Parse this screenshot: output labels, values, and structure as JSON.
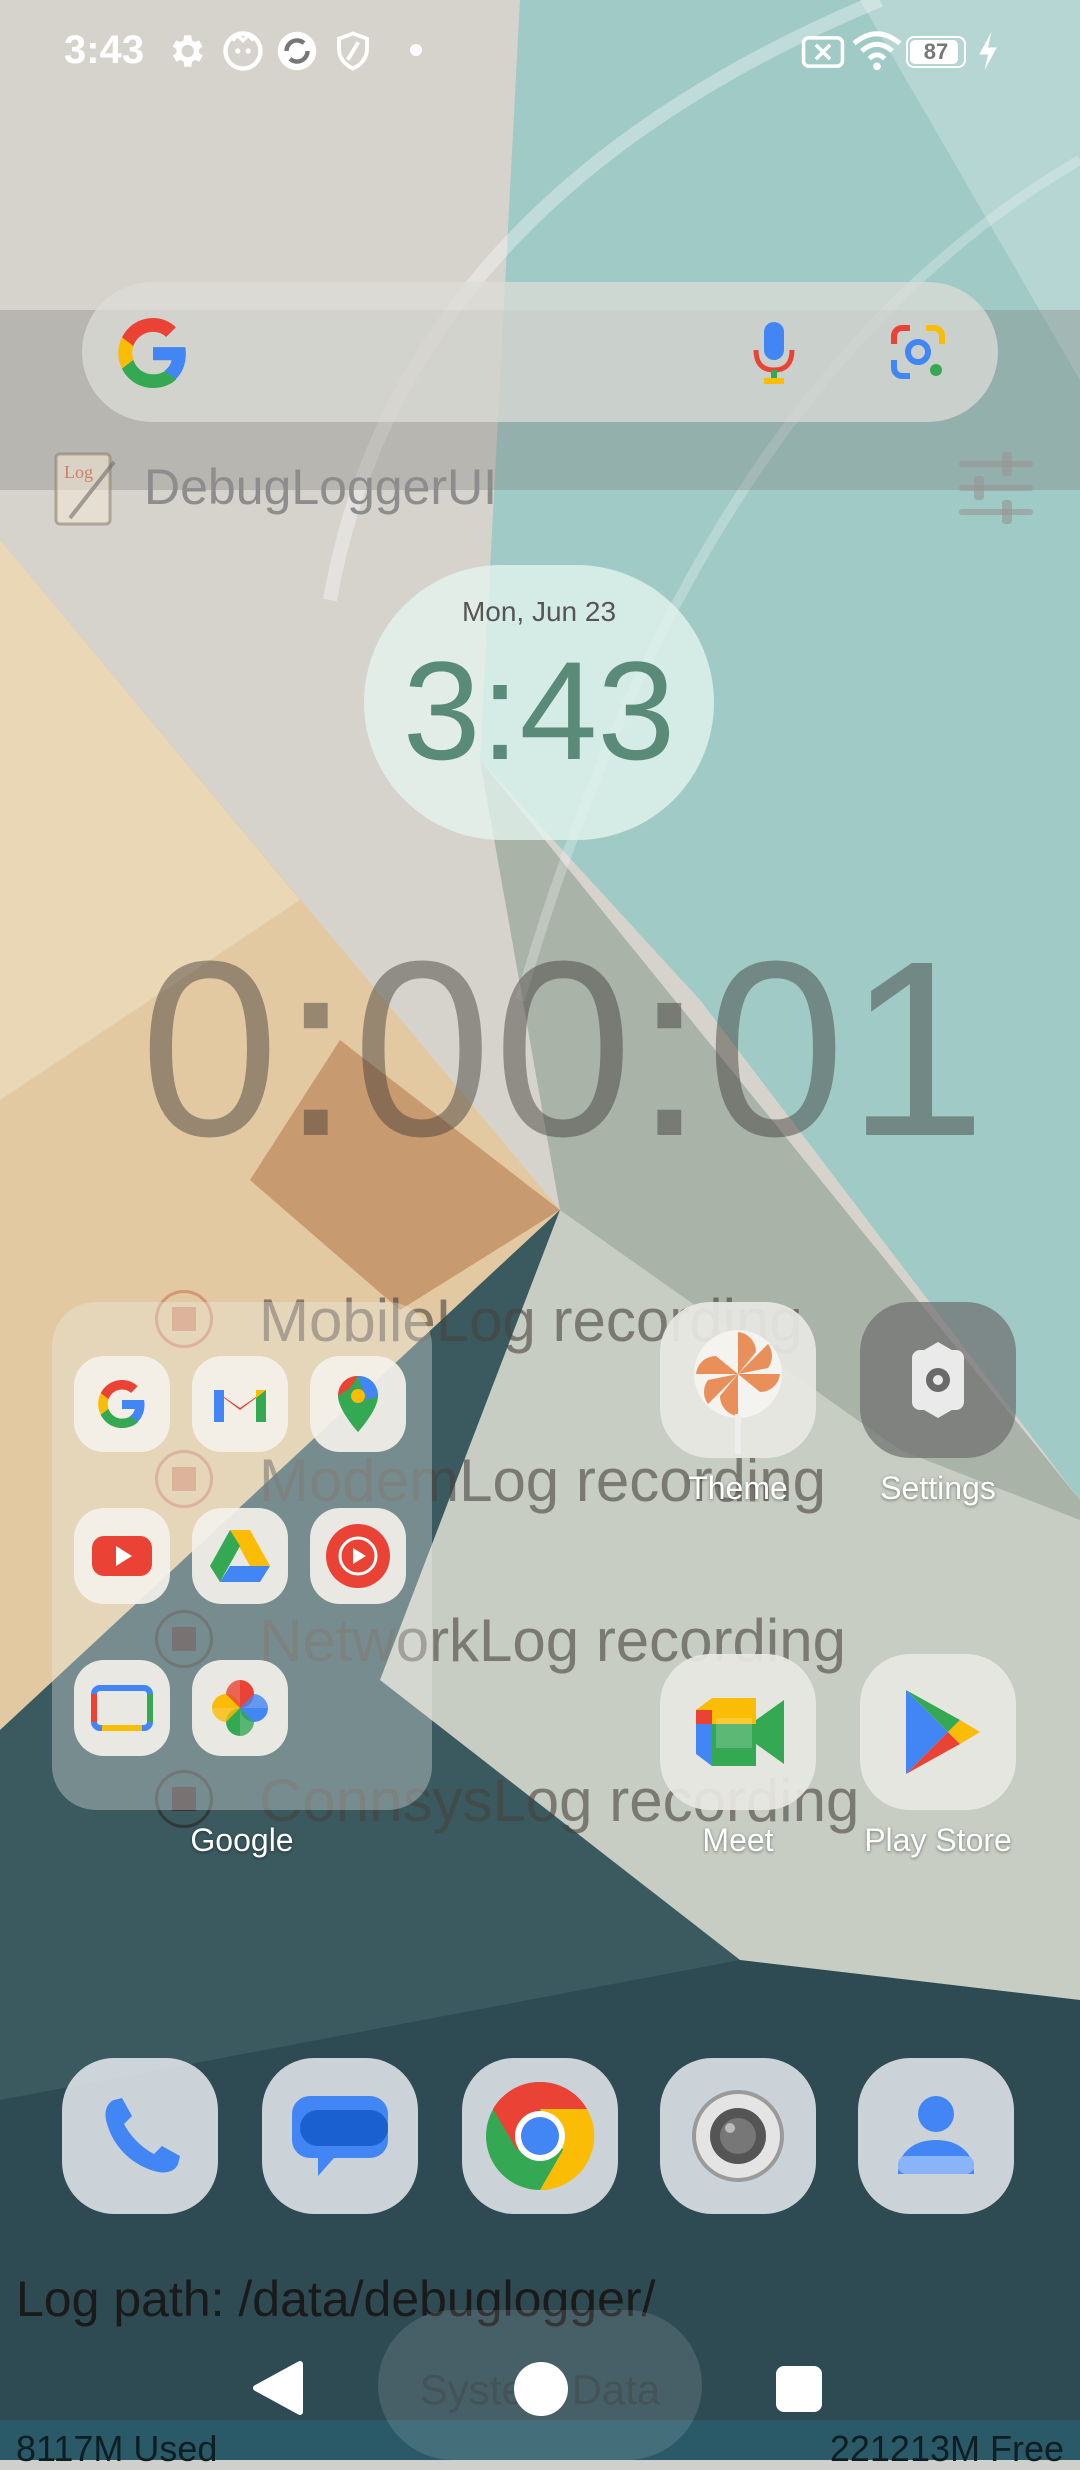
{
  "status_bar": {
    "time": "3:43",
    "battery": "87"
  },
  "debuglogger": {
    "title": "DebugLoggerUI",
    "timer": "0:00:01",
    "logs": [
      {
        "label": "MobileLog recording"
      },
      {
        "label": "ModemLog recording"
      },
      {
        "label": "NetworkLog recording"
      },
      {
        "label": "ConnsysLog recording"
      }
    ],
    "log_path": "Log path: /data/debuglogger/",
    "system_data_button": "System Data",
    "used": "8117M Used",
    "free": "221213M Free"
  },
  "clock_widget": {
    "date": "Mon, Jun 23",
    "time": "3:43"
  },
  "folder": {
    "name": "Google",
    "apps": [
      "google-icon",
      "gmail-icon",
      "maps-icon",
      "youtube-icon",
      "drive-icon",
      "youtube-music-icon",
      "google-tv-icon",
      "photos-icon"
    ]
  },
  "apps": [
    {
      "label": "Theme"
    },
    {
      "label": "Settings"
    },
    {
      "label": "Meet"
    },
    {
      "label": "Play Store"
    }
  ],
  "dock": [
    "phone-icon",
    "messages-icon",
    "chrome-icon",
    "camera-icon",
    "contacts-icon"
  ],
  "colors": {
    "google_blue": "#4285F4",
    "google_red": "#EA4335",
    "google_yellow": "#FBBC05",
    "google_green": "#34A853"
  }
}
